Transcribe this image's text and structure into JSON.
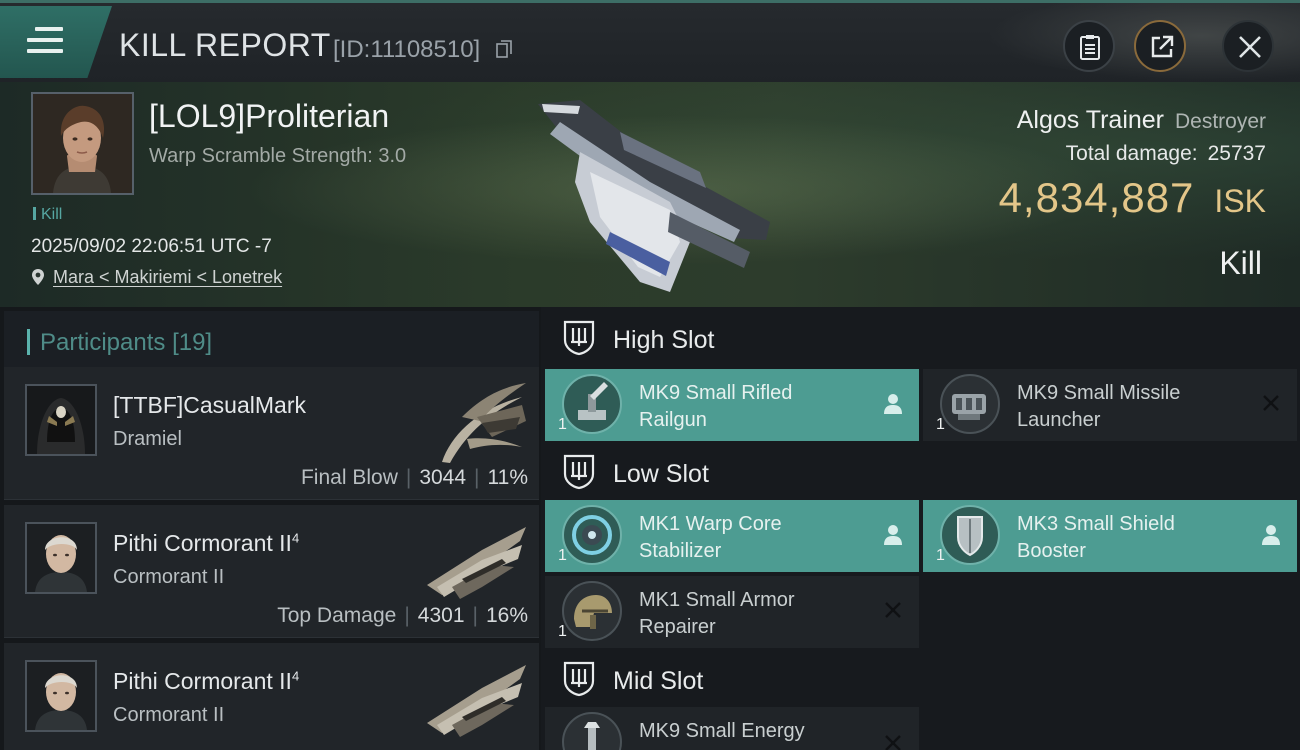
{
  "header": {
    "title": "KILL REPORT",
    "report_id": "[ID:11108510]"
  },
  "victim": {
    "pilot": "[LOL9]Proliterian",
    "warp_scramble": "Warp Scramble Strength: 3.0",
    "tag": "Kill",
    "timestamp": "2025/09/02 22:06:51 UTC -7",
    "location": "Mara < Makiriemi < Lonetrek",
    "ship_name": "Algos Trainer",
    "ship_class": "Destroyer",
    "total_damage_label": "Total damage:",
    "total_damage": "25737",
    "isk_value": "4,834,887",
    "isk_currency": "ISK",
    "result": "Kill"
  },
  "participants": {
    "label": "Participants",
    "count": "[19]",
    "items": [
      {
        "name": "[TTBF]CasualMark",
        "sup": "",
        "ship": "Dramiel",
        "stat_label": "Final Blow",
        "damage": "3044",
        "percent": "11%"
      },
      {
        "name": "Pithi Cormorant II",
        "sup": "4",
        "ship": "Cormorant II",
        "stat_label": "Top Damage",
        "damage": "4301",
        "percent": "16%"
      },
      {
        "name": "Pithi Cormorant II",
        "sup": "4",
        "ship": "Cormorant II",
        "stat_label": "",
        "damage": "",
        "percent": ""
      }
    ]
  },
  "fitting": {
    "high_slot": {
      "title": "High Slot",
      "modules": [
        {
          "qty": "1",
          "name_line1": "MK9 Small Rifled",
          "name_line2": "Railgun",
          "status": "dropped"
        },
        {
          "qty": "1",
          "name_line1": "MK9 Small Missile",
          "name_line2": "Launcher",
          "status": "destroyed"
        }
      ]
    },
    "low_slot": {
      "title": "Low Slot",
      "modules": [
        {
          "qty": "1",
          "name_line1": "MK1 Warp Core",
          "name_line2": "Stabilizer",
          "status": "dropped"
        },
        {
          "qty": "1",
          "name_line1": "MK3 Small Shield",
          "name_line2": "Booster",
          "status": "dropped"
        },
        {
          "qty": "1",
          "name_line1": "MK1 Small Armor",
          "name_line2": "Repairer",
          "status": "destroyed"
        }
      ]
    },
    "mid_slot": {
      "title": "Mid Slot",
      "modules": [
        {
          "qty": "1",
          "name_line1": "MK9 Small Energy",
          "name_line2": "",
          "status": "destroyed"
        }
      ]
    }
  },
  "colors": {
    "accent": "#4d9c92",
    "isk": "#e3c689",
    "participants_label": "#4f8c88"
  }
}
